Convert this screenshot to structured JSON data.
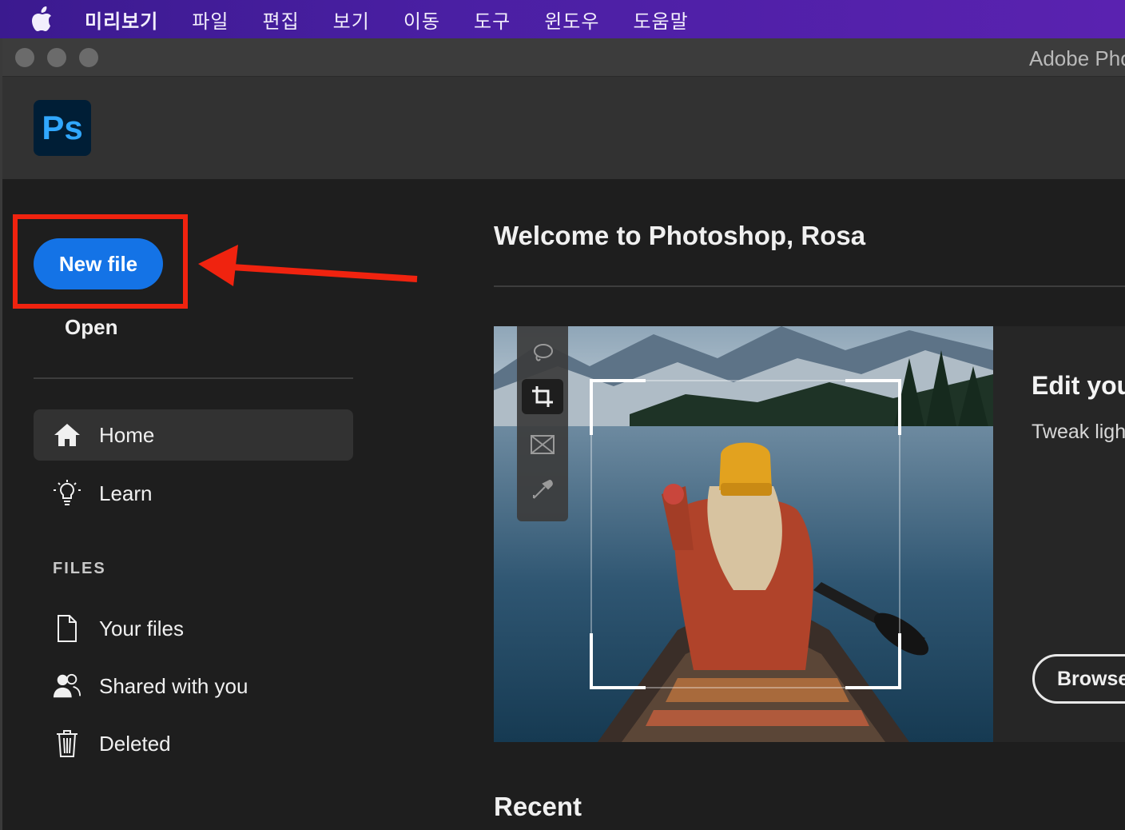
{
  "menubar": {
    "items": [
      "미리보기",
      "파일",
      "편집",
      "보기",
      "이동",
      "도구",
      "윈도우",
      "도움말"
    ]
  },
  "window": {
    "title": "Adobe Pho"
  },
  "app": {
    "logo_text": "Ps",
    "brand_color": "#31a8ff"
  },
  "sidebar": {
    "new_file_label": "New file",
    "open_label": "Open",
    "nav": [
      {
        "label": "Home",
        "icon": "home-icon",
        "active": true
      },
      {
        "label": "Learn",
        "icon": "lightbulb-icon",
        "active": false
      }
    ],
    "files_heading": "FILES",
    "files": [
      {
        "label": "Your files",
        "icon": "document-icon"
      },
      {
        "label": "Shared with you",
        "icon": "people-icon"
      },
      {
        "label": "Deleted",
        "icon": "trash-icon"
      }
    ]
  },
  "main": {
    "welcome": "Welcome to Photoshop, Rosa",
    "hero": {
      "title": "Edit you",
      "subtitle": "Tweak ligh",
      "button": "Browse"
    },
    "recent_heading": "Recent"
  },
  "colors": {
    "accent": "#1473e6",
    "highlight": "#f0230f"
  }
}
